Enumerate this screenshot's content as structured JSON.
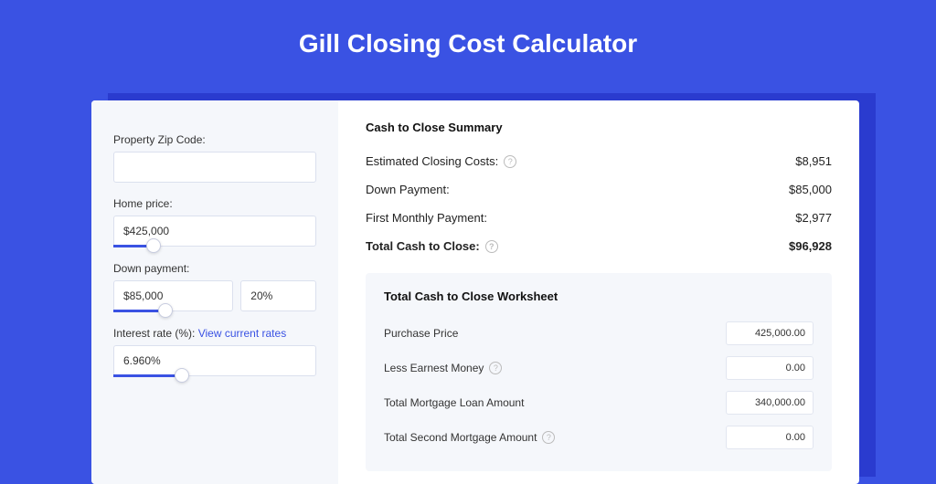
{
  "title": "Gill Closing Cost Calculator",
  "left": {
    "zip_label": "Property Zip Code:",
    "zip_value": "",
    "home_price_label": "Home price:",
    "home_price_value": "$425,000",
    "down_payment_label": "Down payment:",
    "down_payment_value": "$85,000",
    "down_payment_pct": "20%",
    "interest_label": "Interest rate (%): ",
    "interest_link": "View current rates",
    "interest_value": "6.960%"
  },
  "summary": {
    "title": "Cash to Close Summary",
    "rows": [
      {
        "label": "Estimated Closing Costs:",
        "help": true,
        "value": "$8,951"
      },
      {
        "label": "Down Payment:",
        "help": false,
        "value": "$85,000"
      },
      {
        "label": "First Monthly Payment:",
        "help": false,
        "value": "$2,977"
      }
    ],
    "total_label": "Total Cash to Close:",
    "total_value": "$96,928"
  },
  "worksheet": {
    "title": "Total Cash to Close Worksheet",
    "rows": [
      {
        "label": "Purchase Price",
        "help": false,
        "value": "425,000.00"
      },
      {
        "label": "Less Earnest Money",
        "help": true,
        "value": "0.00"
      },
      {
        "label": "Total Mortgage Loan Amount",
        "help": false,
        "value": "340,000.00"
      },
      {
        "label": "Total Second Mortgage Amount",
        "help": true,
        "value": "0.00"
      }
    ]
  }
}
